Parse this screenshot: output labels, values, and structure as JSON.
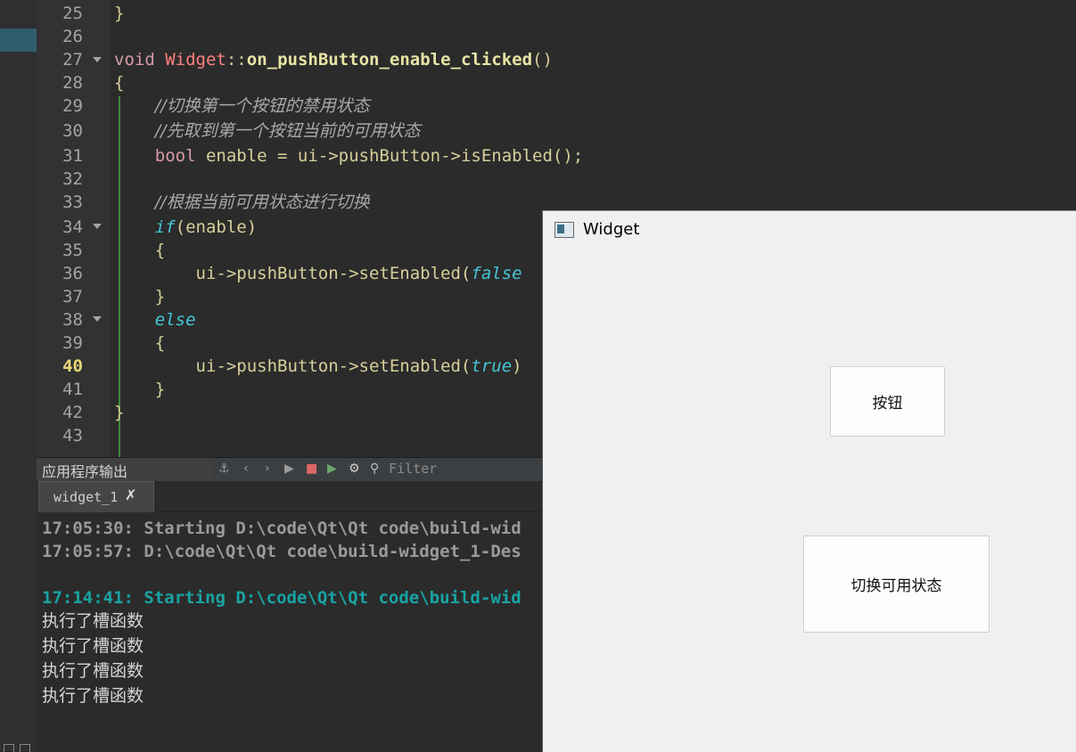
{
  "editor": {
    "lines": [
      {
        "n": "25"
      },
      {
        "n": "26"
      },
      {
        "n": "27"
      },
      {
        "n": "28"
      },
      {
        "n": "29"
      },
      {
        "n": "30"
      },
      {
        "n": "31"
      },
      {
        "n": "32"
      },
      {
        "n": "33"
      },
      {
        "n": "34"
      },
      {
        "n": "35"
      },
      {
        "n": "36"
      },
      {
        "n": "37"
      },
      {
        "n": "38"
      },
      {
        "n": "39"
      },
      {
        "n": "40"
      },
      {
        "n": "41"
      },
      {
        "n": "42"
      },
      {
        "n": "43"
      }
    ],
    "current_line": "40",
    "code": {
      "l25": "}",
      "l27_kw": "void",
      "l27_cls": "Widget",
      "l27_op": "::",
      "l27_fn": "on_pushButton_enable_clicked",
      "l27_rest": "()",
      "l28": "{",
      "l29": "//切换第一个按钮的禁用状态",
      "l30": "//先取到第一个按钮当前的可用状态",
      "l31_kw": "bool",
      "l31_rest": " enable = ui->pushButton->isEnabled();",
      "l33": "//根据当前可用状态进行切换",
      "l34_kw": "if",
      "l34_rest": "(enable)",
      "l35": "{",
      "l36_a": "ui->pushButton->setEnabled(",
      "l36_b": "false",
      "l37": "}",
      "l38": "else",
      "l39": "{",
      "l40_a": "ui->pushButton->setEnabled(",
      "l40_b": "true",
      "l40_c": ")",
      "l41": "}",
      "l42": "}"
    }
  },
  "output": {
    "title": "应用程序输出",
    "filter_placeholder": "Filter",
    "tab_label": "widget_1",
    "tab_close": "✗",
    "lines": [
      "17:05:30: Starting D:\\code\\Qt\\Qt code\\build-wid",
      "17:05:57: D:\\code\\Qt\\Qt code\\build-widget_1-Des",
      "17:14:41: Starting D:\\code\\Qt\\Qt code\\build-wid",
      "执行了槽函数",
      "执行了槽函数",
      "执行了槽函数",
      "执行了槽函数"
    ]
  },
  "widget_window": {
    "title": "Widget",
    "button1_label": "按钮",
    "button2_label": "切换可用状态"
  },
  "colors": {
    "editor_bg": "#2b2b2b",
    "keyword": "#d69aa7",
    "class": "#ff8080",
    "function": "#e7e4a5",
    "comment": "#a8a8a8",
    "literal": "#45c6d6",
    "teal_output": "#19a3a3",
    "window_bg": "#f0f0f0"
  }
}
